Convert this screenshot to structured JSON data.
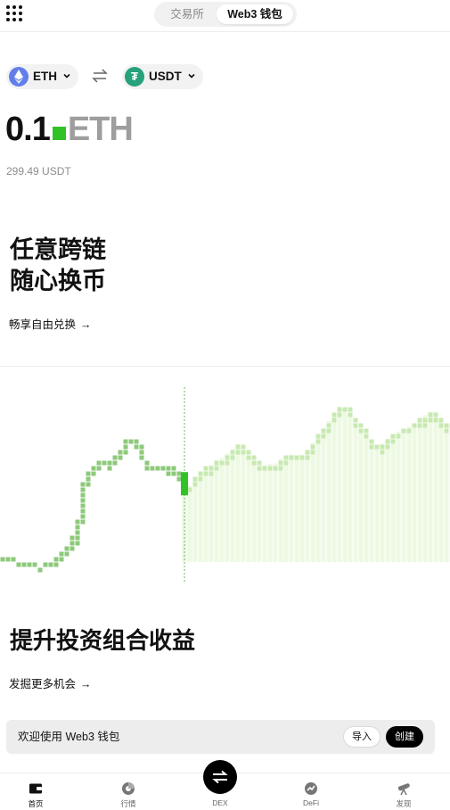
{
  "header": {
    "tabs": [
      {
        "label": "交易所",
        "active": false
      },
      {
        "label": "Web3 钱包",
        "active": true
      }
    ]
  },
  "swap": {
    "from_token": "ETH",
    "to_token": "USDT",
    "to_token_glyph": "₮",
    "amount": "0.1",
    "amount_unit": "ETH",
    "fiat_value": "299.49 USDT"
  },
  "promo1": {
    "line1": "任意跨链",
    "line2": "随心换币",
    "link": "畅享自由兑换"
  },
  "promo2": {
    "title": "提升投资组合收益",
    "link": "发掘更多机会"
  },
  "arrow": "→",
  "welcome": {
    "text": "欢迎使用 Web3 钱包",
    "import_label": "导入",
    "create_label": "创建"
  },
  "nav": {
    "items": [
      {
        "label": "首页",
        "icon": "wallet-icon",
        "active": true
      },
      {
        "label": "行情",
        "icon": "market-icon",
        "active": false
      },
      {
        "label": "DEX",
        "icon": "swap-icon",
        "active": false
      },
      {
        "label": "DeFi",
        "icon": "defi-icon",
        "active": false
      },
      {
        "label": "发现",
        "icon": "discover-icon",
        "active": false
      }
    ]
  },
  "colors": {
    "accent_green": "#31c227",
    "chart_green": "#8dc97a",
    "chart_fill": "#eef9e3",
    "eth_blue": "#627eea",
    "usdt_green": "#26a17b"
  },
  "chart_data": {
    "type": "line",
    "values": [
      29,
      29,
      28,
      28,
      27,
      27,
      28,
      29,
      31,
      33,
      39,
      55,
      57,
      59,
      58,
      60,
      62,
      66,
      64,
      59,
      57,
      58,
      58,
      56,
      54,
      50,
      53,
      56,
      57,
      59,
      60,
      62,
      64,
      61,
      59,
      57,
      58,
      58,
      60,
      61,
      60,
      61,
      64,
      67,
      70,
      73,
      76,
      73,
      70,
      67,
      64,
      63,
      65,
      67,
      68,
      69,
      70,
      72,
      74,
      72,
      70,
      69
    ],
    "highlight_index": 25,
    "ylim": [
      20,
      85
    ]
  }
}
